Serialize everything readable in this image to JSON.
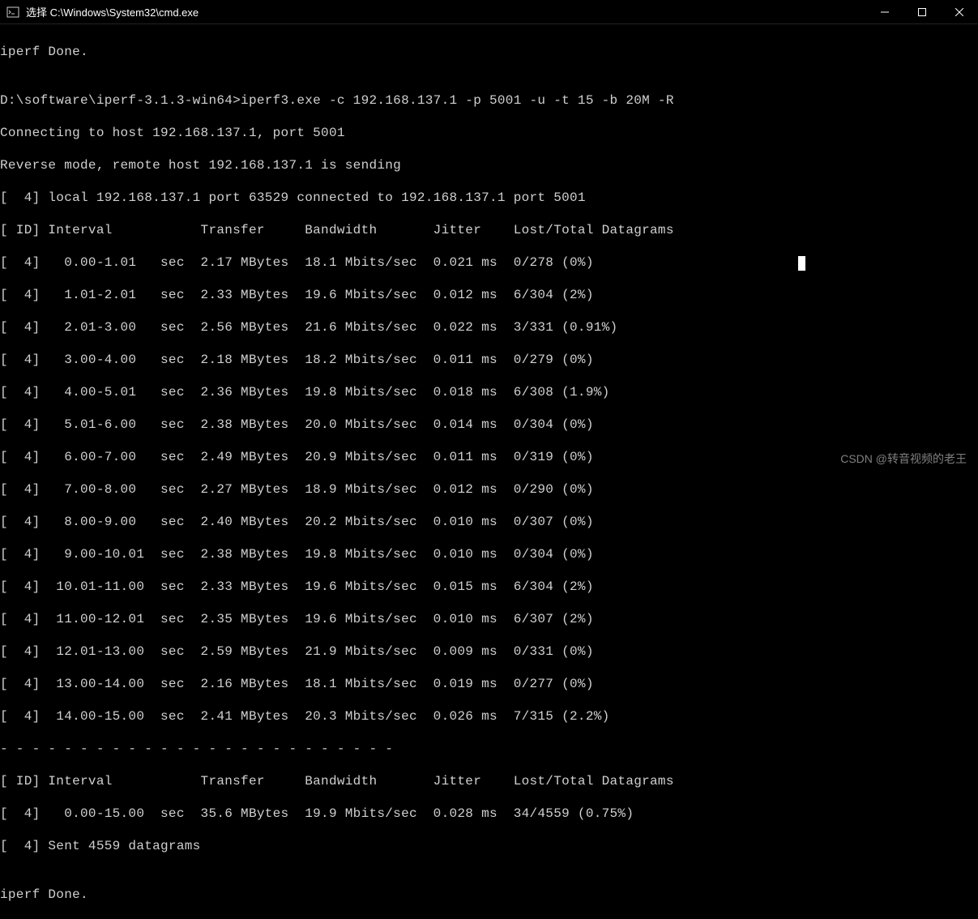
{
  "window": {
    "title": "选择 C:\\Windows\\System32\\cmd.exe"
  },
  "terminal": {
    "done1": "iperf Done.",
    "blank1": "",
    "prompt": "D:\\software\\iperf-3.1.3-win64>iperf3.exe -c 192.168.137.1 -p 5001 -u -t 15 -b 20M -R",
    "connecting": "Connecting to host 192.168.137.1, port 5001",
    "reverse": "Reverse mode, remote host 192.168.137.1 is sending",
    "local": "[  4] local 192.168.137.1 port 63529 connected to 192.168.137.1 port 5001",
    "header1": "[ ID] Interval           Transfer     Bandwidth       Jitter    Lost/Total Datagrams",
    "rows": [
      "[  4]   0.00-1.01   sec  2.17 MBytes  18.1 Mbits/sec  0.021 ms  0/278 (0%)",
      "[  4]   1.01-2.01   sec  2.33 MBytes  19.6 Mbits/sec  0.012 ms  6/304 (2%)",
      "[  4]   2.01-3.00   sec  2.56 MBytes  21.6 Mbits/sec  0.022 ms  3/331 (0.91%)",
      "[  4]   3.00-4.00   sec  2.18 MBytes  18.2 Mbits/sec  0.011 ms  0/279 (0%)",
      "[  4]   4.00-5.01   sec  2.36 MBytes  19.8 Mbits/sec  0.018 ms  6/308 (1.9%)",
      "[  4]   5.01-6.00   sec  2.38 MBytes  20.0 Mbits/sec  0.014 ms  0/304 (0%)",
      "[  4]   6.00-7.00   sec  2.49 MBytes  20.9 Mbits/sec  0.011 ms  0/319 (0%)",
      "[  4]   7.00-8.00   sec  2.27 MBytes  18.9 Mbits/sec  0.012 ms  0/290 (0%)",
      "[  4]   8.00-9.00   sec  2.40 MBytes  20.2 Mbits/sec  0.010 ms  0/307 (0%)",
      "[  4]   9.00-10.01  sec  2.38 MBytes  19.8 Mbits/sec  0.010 ms  0/304 (0%)",
      "[  4]  10.01-11.00  sec  2.33 MBytes  19.6 Mbits/sec  0.015 ms  6/304 (2%)",
      "[  4]  11.00-12.01  sec  2.35 MBytes  19.6 Mbits/sec  0.010 ms  6/307 (2%)",
      "[  4]  12.01-13.00  sec  2.59 MBytes  21.9 Mbits/sec  0.009 ms  0/331 (0%)",
      "[  4]  13.00-14.00  sec  2.16 MBytes  18.1 Mbits/sec  0.019 ms  0/277 (0%)",
      "[  4]  14.00-15.00  sec  2.41 MBytes  20.3 Mbits/sec  0.026 ms  7/315 (2.2%)"
    ],
    "sep": "- - - - - - - - - - - - - - - - - - - - - - - - -",
    "header2": "[ ID] Interval           Transfer     Bandwidth       Jitter    Lost/Total Datagrams",
    "summary": "[  4]   0.00-15.00  sec  35.6 MBytes  19.9 Mbits/sec  0.028 ms  34/4559 (0.75%)",
    "sent": "[  4] Sent 4559 datagrams",
    "blank2": "",
    "done2": "iperf Done."
  },
  "watermark": "CSDN @转音视频的老王"
}
